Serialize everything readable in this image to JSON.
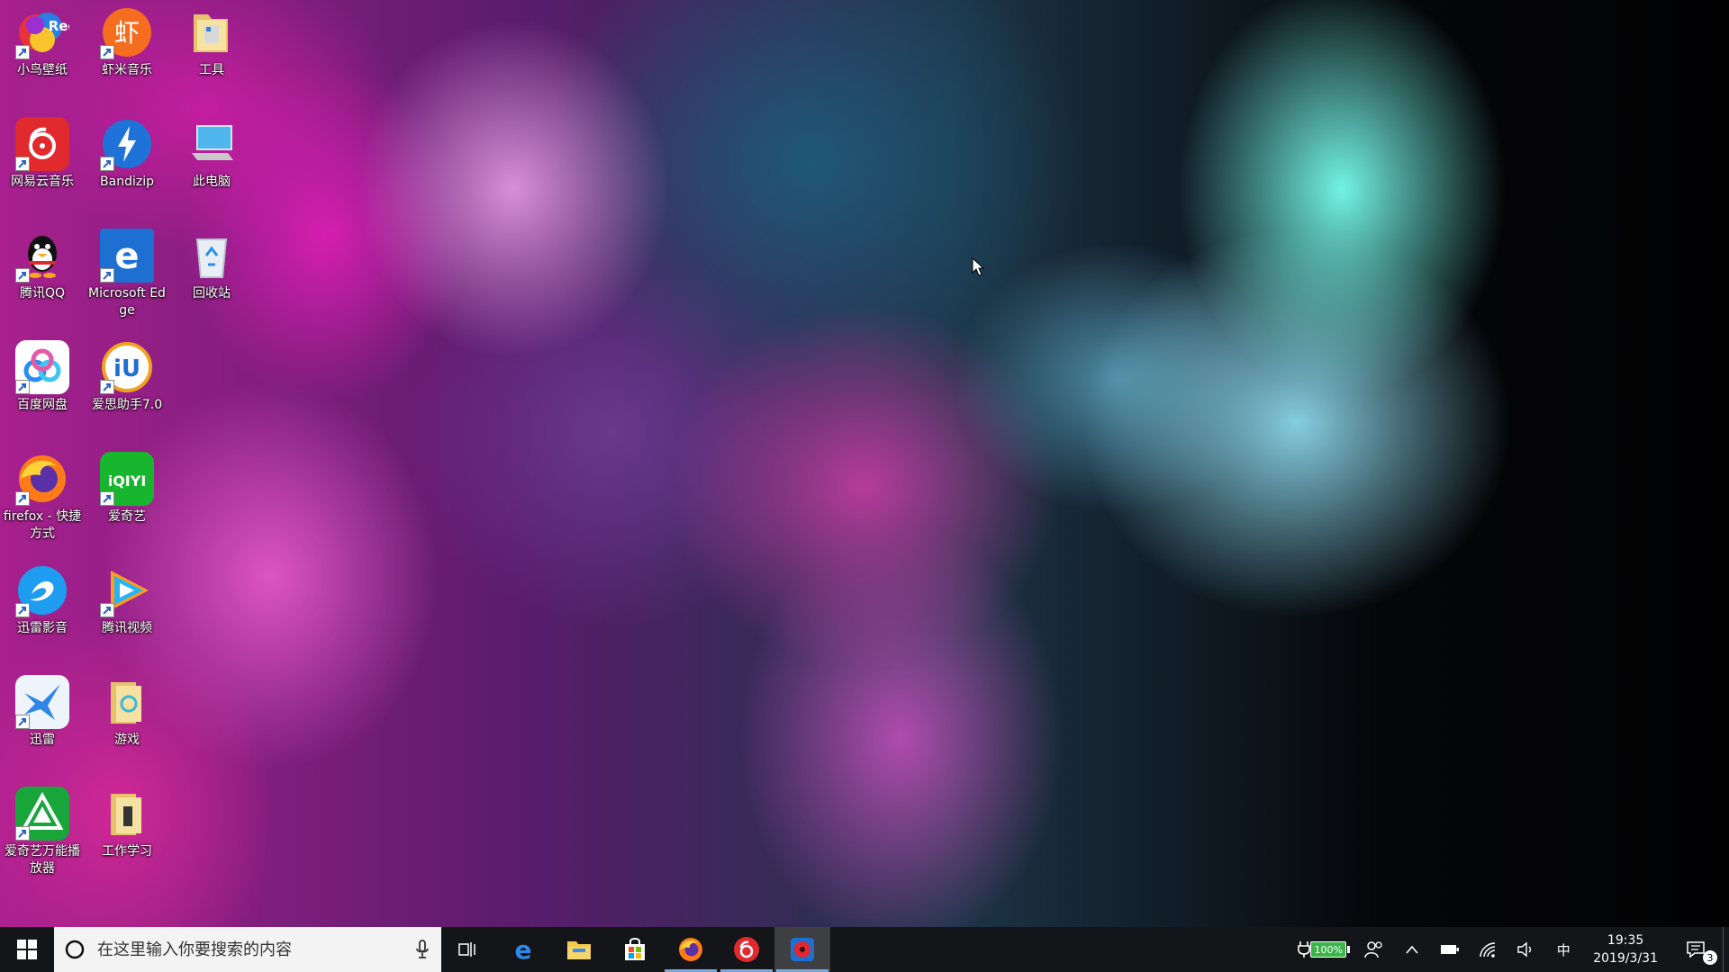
{
  "desktop": {
    "icons": [
      {
        "label": "小鸟壁纸",
        "icon": "bird-wallpaper-icon"
      },
      {
        "label": "虾米音乐",
        "icon": "xiami-music-icon"
      },
      {
        "label": "工具",
        "icon": "folder-icon"
      },
      {
        "label": "网易云音乐",
        "icon": "netease-music-icon"
      },
      {
        "label": "Bandizip",
        "icon": "bandizip-icon"
      },
      {
        "label": "此电脑",
        "icon": "this-pc-icon"
      },
      {
        "label": "腾讯QQ",
        "icon": "qq-penguin-icon"
      },
      {
        "label": "Microsoft Edge",
        "icon": "edge-icon"
      },
      {
        "label": "回收站",
        "icon": "recycle-bin-icon"
      },
      {
        "label": "百度网盘",
        "icon": "baidu-netdisk-icon"
      },
      {
        "label": "爱思助手7.0",
        "icon": "i4-assistant-icon"
      },
      {
        "label": "firefox - 快捷方式",
        "icon": "firefox-icon"
      },
      {
        "label": "爱奇艺",
        "icon": "iqiyi-icon"
      },
      {
        "label": "迅雷影音",
        "icon": "xunlei-player-icon"
      },
      {
        "label": "腾讯视频",
        "icon": "tencent-video-icon"
      },
      {
        "label": "迅雷",
        "icon": "xunlei-icon"
      },
      {
        "label": "游戏",
        "icon": "games-folder-icon"
      },
      {
        "label": "爱奇艺万能播放器",
        "icon": "iqiyi-player-icon"
      },
      {
        "label": "工作学习",
        "icon": "work-folder-icon"
      }
    ],
    "icon_badges": {
      "rec_label": "Rec",
      "xiami_glyph": "虾",
      "iqiyi_glyph": "iQIYI",
      "i4_glyph": "iU"
    }
  },
  "taskbar": {
    "search": {
      "placeholder": "在这里输入你要搜索的内容"
    },
    "pinned": [
      {
        "name": "edge",
        "icon": "edge-icon"
      },
      {
        "name": "file-explorer",
        "icon": "folder-icon"
      },
      {
        "name": "store",
        "icon": "store-icon"
      },
      {
        "name": "firefox",
        "icon": "firefox-icon"
      },
      {
        "name": "netease-music",
        "icon": "netease-music-icon"
      },
      {
        "name": "bird-wallpaper",
        "icon": "bird-wallpaper-icon"
      }
    ],
    "tray": {
      "battery_percent": "100%",
      "input_method": "中",
      "time": "19:35",
      "date": "2019/3/31",
      "notification_count": "3"
    }
  },
  "colors": {
    "taskbar_bg": "#14161a",
    "search_bg": "#f3f3f3",
    "battery_fill": "#39b54a",
    "running_indicator": "#7aa7d9"
  }
}
